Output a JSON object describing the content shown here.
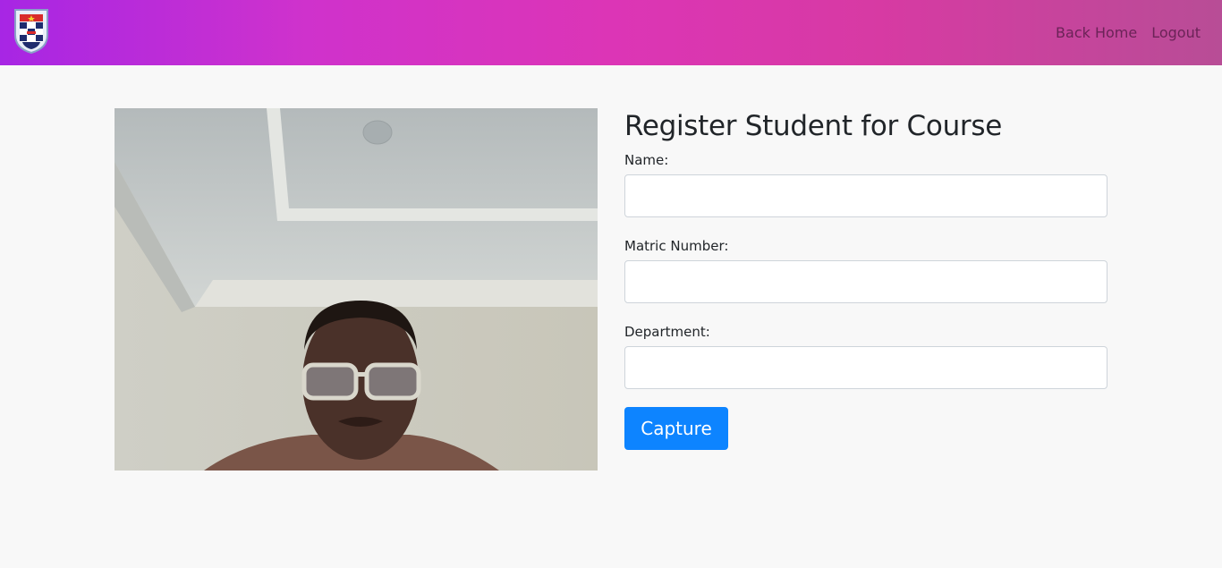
{
  "navbar": {
    "logo_icon": "university-crest-icon",
    "links": [
      {
        "label": "Back Home"
      },
      {
        "label": "Logout"
      }
    ],
    "gradient": [
      "#a726e4",
      "#dc35b6",
      "#b84d96"
    ]
  },
  "webcam": {
    "icon": "webcam-feed-image"
  },
  "form": {
    "title": "Register Student for Course",
    "fields": [
      {
        "label": "Name:",
        "value": "",
        "placeholder": ""
      },
      {
        "label": "Matric Number:",
        "value": "",
        "placeholder": ""
      },
      {
        "label": "Department:",
        "value": "",
        "placeholder": ""
      }
    ],
    "capture_label": "Capture",
    "accent": "#0d84ff"
  }
}
